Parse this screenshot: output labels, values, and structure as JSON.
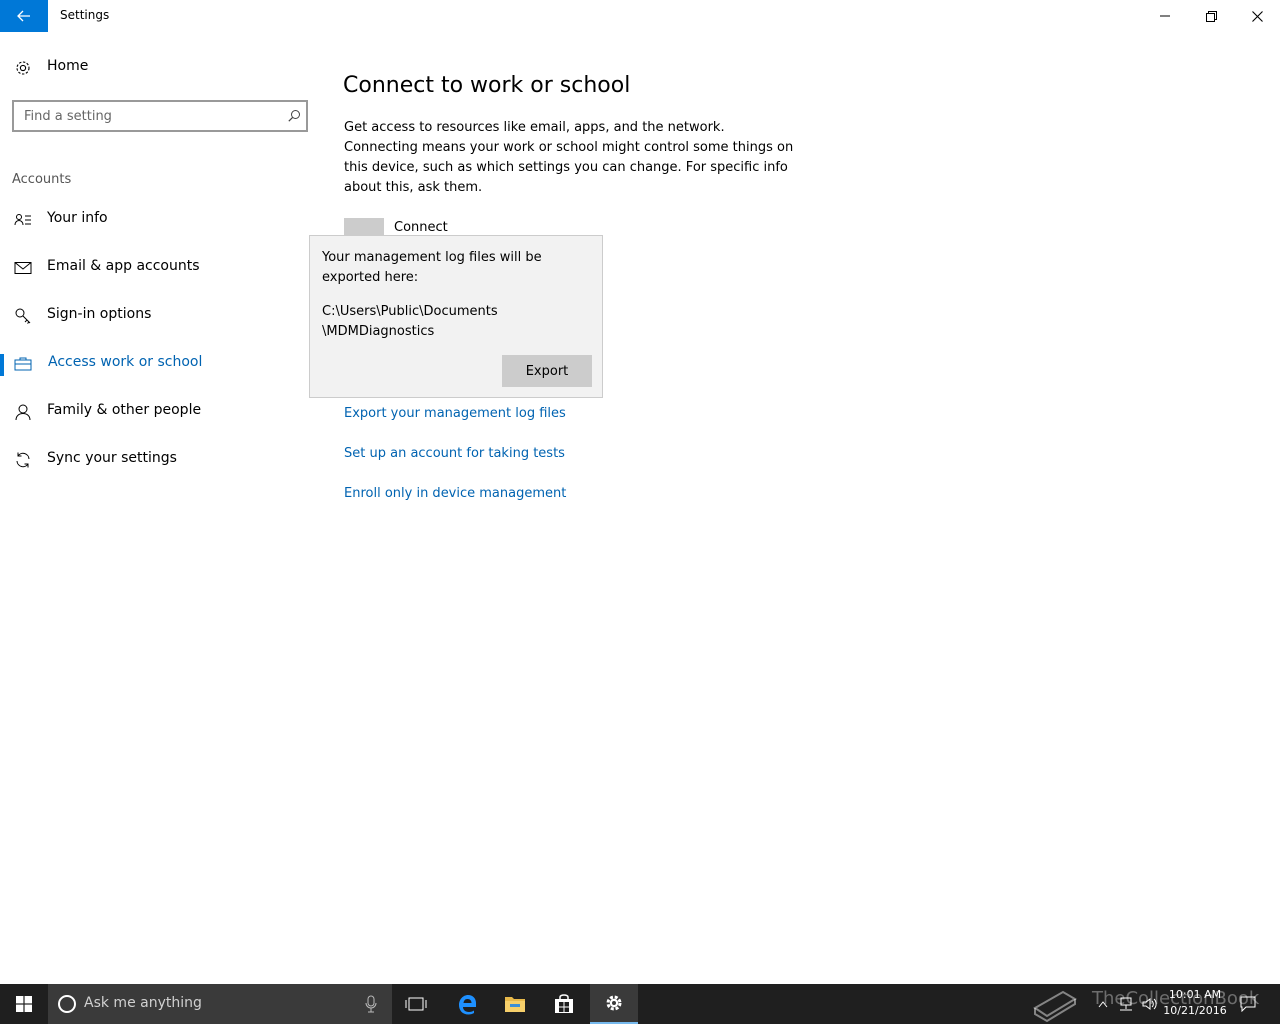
{
  "window": {
    "title": "Settings"
  },
  "sidebar": {
    "home_label": "Home",
    "search_placeholder": "Find a setting",
    "section_label": "Accounts",
    "items": [
      {
        "label": "Your info",
        "icon": "contact-card-icon"
      },
      {
        "label": "Email & app accounts",
        "icon": "mail-icon"
      },
      {
        "label": "Sign-in options",
        "icon": "key-icon"
      },
      {
        "label": "Access work or school",
        "icon": "briefcase-icon",
        "selected": true
      },
      {
        "label": "Family & other people",
        "icon": "person-icon"
      },
      {
        "label": "Sync your settings",
        "icon": "sync-icon"
      }
    ]
  },
  "main": {
    "title": "Connect to work or school",
    "description": "Get access to resources like email, apps, and the network. Connecting means your work or school might control some things on this device, such as which settings you can change. For specific info about this, ask them.",
    "connect_label": "Connect",
    "links": [
      "Export your management log files",
      "Set up an account for taking tests",
      "Enroll only in device management"
    ]
  },
  "flyout": {
    "message": "Your management log files will be exported here:",
    "path_line1": "C:\\Users\\Public\\Documents",
    "path_line2": "\\MDMDiagnostics",
    "button_label": "Export"
  },
  "taskbar": {
    "search_placeholder": "Ask me anything",
    "time": "10:01 AM",
    "date": "10/21/2016",
    "watermark": "TheCollectionBook"
  },
  "colors": {
    "accent": "#0078d7",
    "link": "#0063b1",
    "taskbar": "#1f1f1f"
  }
}
